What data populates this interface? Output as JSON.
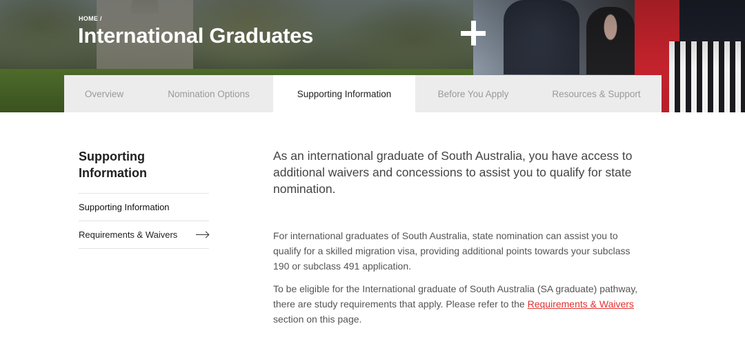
{
  "breadcrumb": "HOME /",
  "page_title": "International Graduates",
  "tabs": [
    {
      "label": "Overview"
    },
    {
      "label": "Nomination Options"
    },
    {
      "label": "Supporting Information"
    },
    {
      "label": "Before You Apply"
    },
    {
      "label": "Resources & Support"
    }
  ],
  "active_tab": "Supporting Information",
  "sidebar": {
    "title": "Supporting Information",
    "items": [
      {
        "label": "Supporting Information"
      },
      {
        "label": "Requirements & Waivers"
      }
    ]
  },
  "content": {
    "lead": "As an international graduate of South Australia, you have access to additional waivers and concessions to assist you to qualify for state nomination.",
    "paragraph1": "For international graduates of South Australia, state nomination can assist you to qualify for a skilled migration visa, providing additional points towards your subclass 190 or subclass 491 application.",
    "paragraph2_before": "To be eligible for the International graduate of South Australia (SA graduate) pathway, there are study requirements that  apply. Please refer to the ",
    "paragraph2_link": "Requirements & Waivers",
    "paragraph2_after": " section on this page."
  },
  "colors": {
    "link": "#e0302f",
    "tab_bar": "#ececec",
    "active_tab": "#ffffff"
  }
}
